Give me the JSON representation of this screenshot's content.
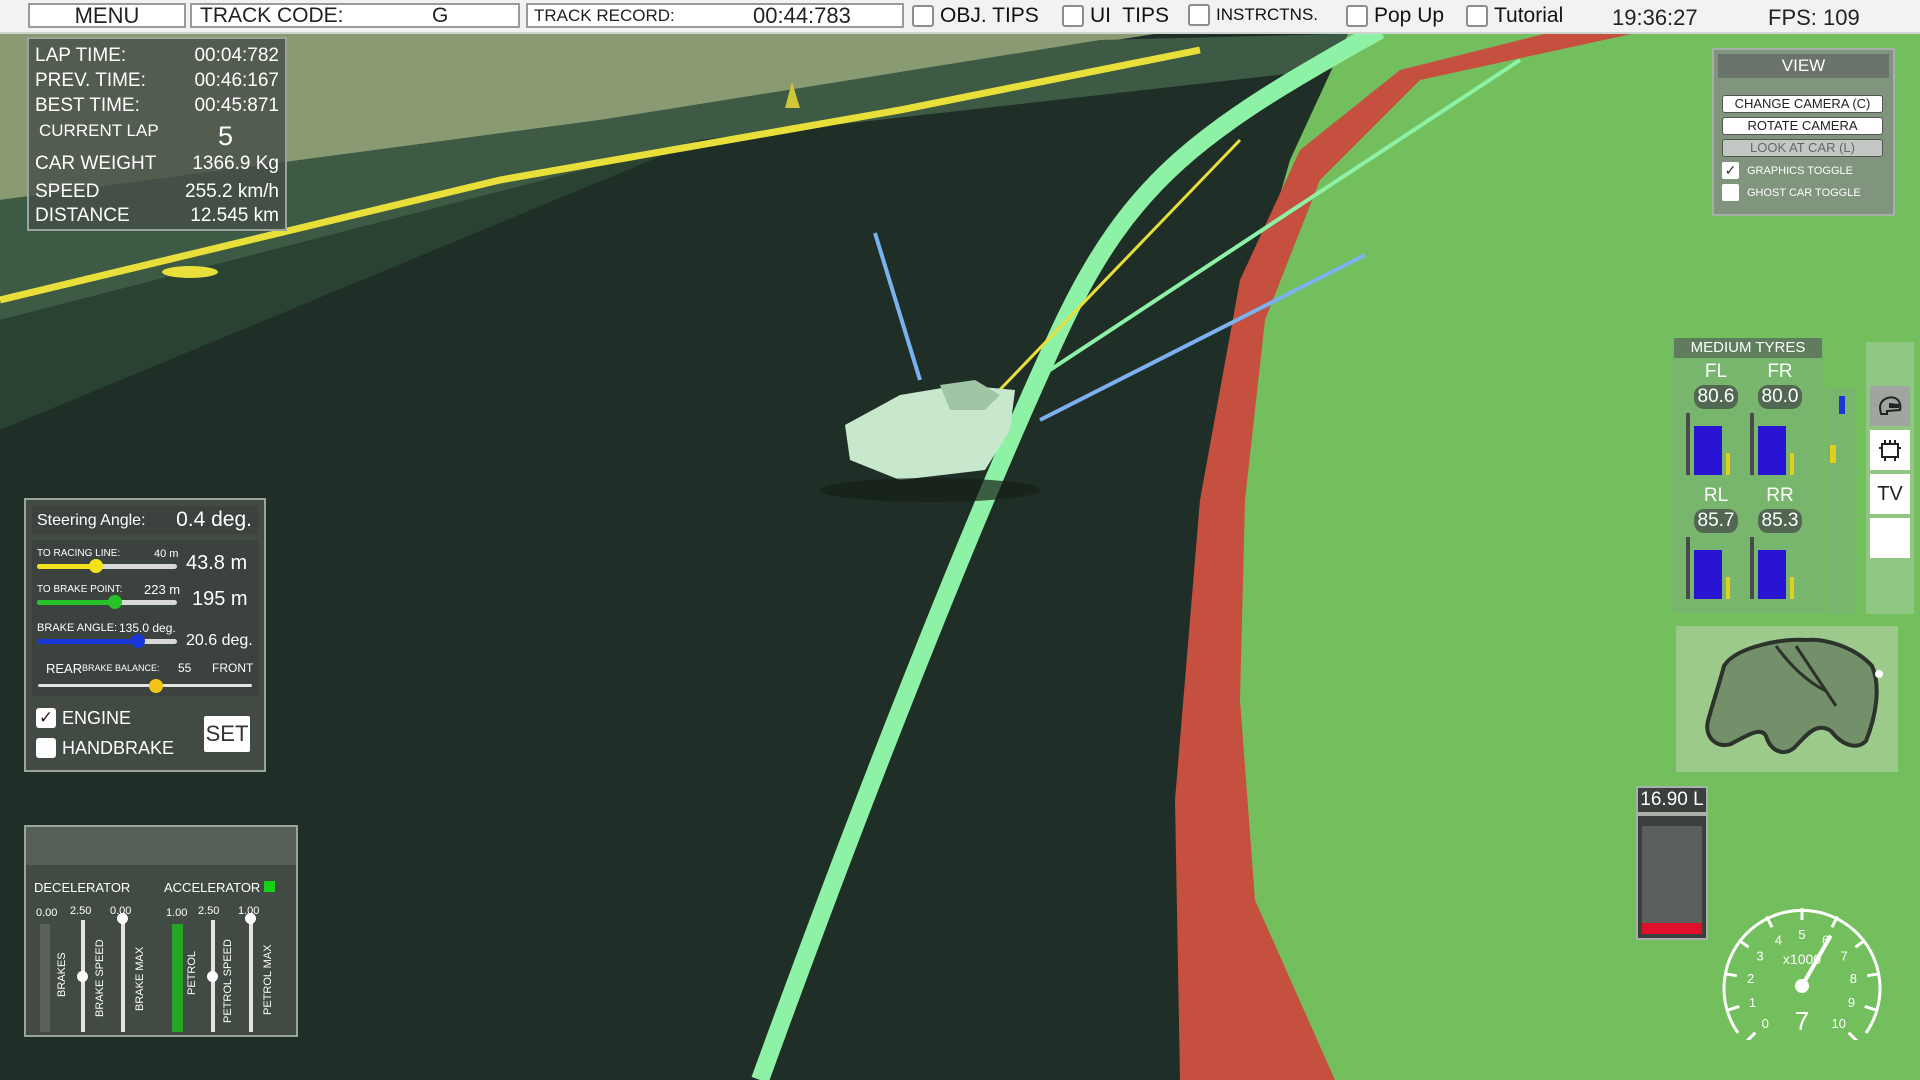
{
  "topbar": {
    "menu_label": "MENU",
    "track_code_label": "TRACK CODE:",
    "track_code_value": "G",
    "track_record_label": "TRACK RECORD:",
    "track_record_value": "00:44:783",
    "toggles": [
      "OBJ. TIPS",
      "UI  TIPS",
      "INSTRCTNS.",
      "Pop Up",
      "Tutorial"
    ],
    "clock": "19:36:27",
    "fps": "FPS: 109"
  },
  "info": {
    "lap_time_label": "LAP TIME:",
    "lap_time": "00:04:782",
    "prev_time_label": "PREV. TIME:",
    "prev_time": "00:46:167",
    "best_time_label": "BEST TIME:",
    "best_time": "00:45:871",
    "current_lap_label": "CURRENT LAP",
    "current_lap": "5",
    "car_weight_label": "CAR WEIGHT",
    "car_weight": "1366.9 Kg",
    "speed_label": "SPEED",
    "speed": "255.2 km/h",
    "distance_label": "DISTANCE",
    "distance": "12.545 km"
  },
  "steering": {
    "angle_label": "Steering Angle:",
    "angle_value": "0.4 deg.",
    "racing_line_label": "TO RACING LINE:",
    "racing_line_setting": "40 m",
    "racing_line_value": "43.8 m",
    "racing_line_level": 0.42,
    "racing_line_color": "#f2e21a",
    "brake_point_label": "TO BRAKE POINT:",
    "brake_point_setting": "223 m",
    "brake_point_value": "195 m",
    "brake_point_level": 0.56,
    "brake_point_color": "#27c227",
    "brake_angle_label": "BRAKE ANGLE:",
    "brake_angle_setting": "135.0 deg.",
    "brake_angle_value": "20.6 deg.",
    "brake_angle_level": 0.72,
    "brake_angle_color": "#1a35d8",
    "balance_rear": "REAR",
    "balance_label": "BRAKE BALANCE:",
    "balance_value": "55",
    "balance_front": "FRONT",
    "balance_level": 0.55,
    "engine_label": "ENGINE",
    "engine_checked": true,
    "handbrake_label": "HANDBRAKE",
    "handbrake_checked": false,
    "set_label": "SET"
  },
  "pedals": {
    "decelerator_label": "DECELERATOR",
    "accelerator_label": "ACCELERATOR",
    "dec_values": [
      "0.00",
      "2.50",
      "0.00"
    ],
    "acc_values": [
      "1.00",
      "2.50",
      "1.00"
    ],
    "dec_labels": [
      "BRAKES",
      "BRAKE SPEED",
      "BRAKE MAX"
    ],
    "acc_labels": [
      "PETROL",
      "PETROL SPEED",
      "PETROL MAX"
    ],
    "petrol_level": 1.0,
    "accel_indicator_color": "#19d019"
  },
  "view": {
    "title": "VIEW",
    "buttons": [
      "CHANGE CAMERA (C)",
      "ROTATE CAMERA",
      "LOOK AT CAR (L)"
    ],
    "graphics_toggle": "GRAPHICS TOGGLE",
    "ghost_toggle": "GHOST CAR TOGGLE"
  },
  "tyres": {
    "title": "MEDIUM TYRES",
    "fl_label": "FL",
    "fl_value": "80.6",
    "fr_label": "FR",
    "fr_value": "80.0",
    "rl_label": "RL",
    "rl_value": "85.7",
    "rr_label": "RR",
    "rr_value": "85.3"
  },
  "side_toolbar": {
    "items": [
      "helmet-icon",
      "engine-icon",
      "TV",
      "blank"
    ],
    "tv_label": "TV"
  },
  "fuel": {
    "value": "16.90 L",
    "level": 0.1,
    "color": "#e0102a"
  },
  "tacho": {
    "multiplier": "x1000",
    "ticks": [
      "0",
      "1",
      "2",
      "3",
      "4",
      "5",
      "6",
      "7",
      "8",
      "9",
      "10"
    ],
    "gear": "7",
    "rpm": 6.1
  },
  "colors": {
    "grass": "#74bf5d",
    "track": "#1f2e26",
    "kerb": "#c5503f",
    "racing_line": "#8ef2a6"
  }
}
